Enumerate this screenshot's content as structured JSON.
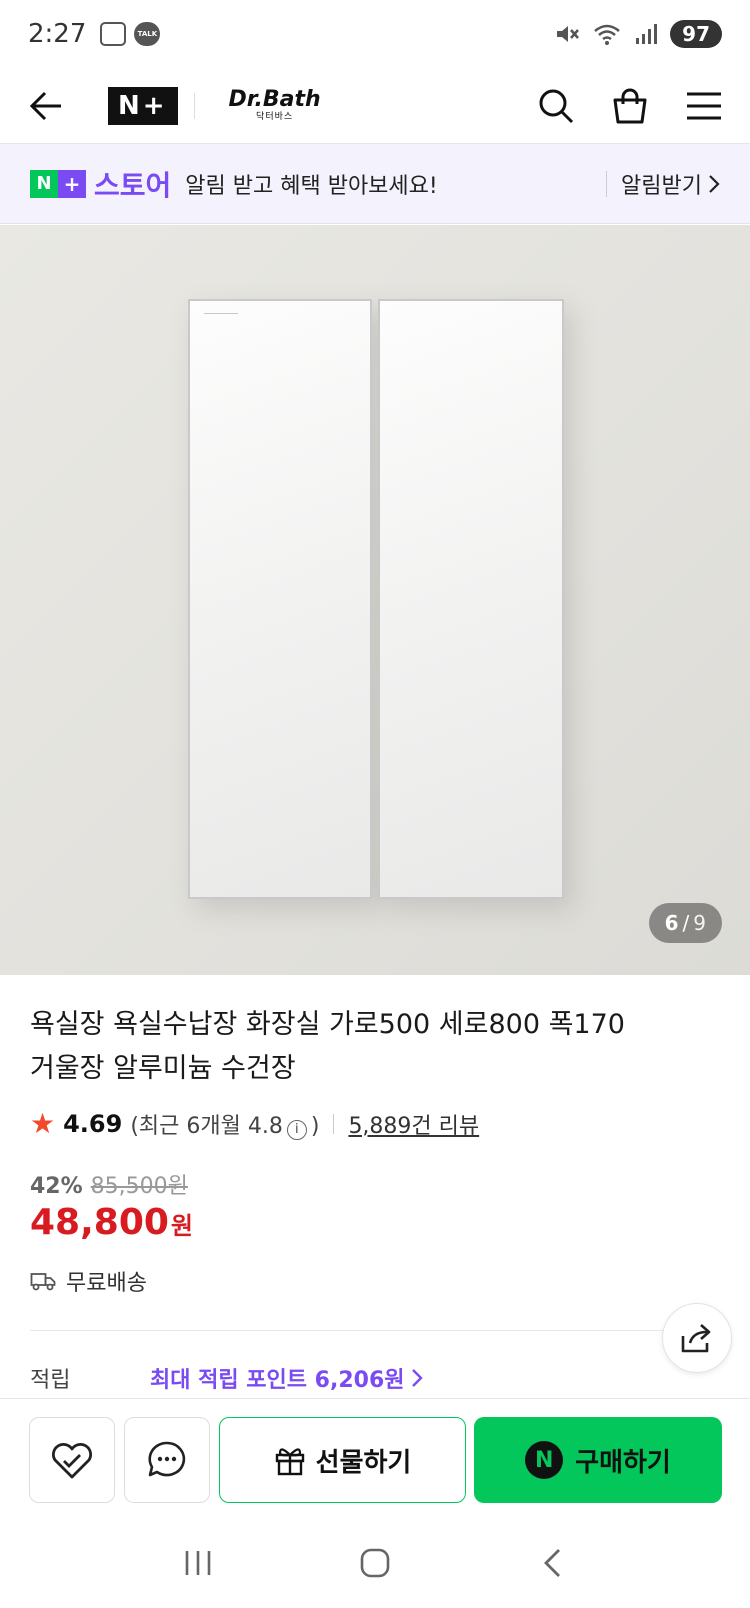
{
  "status_bar": {
    "time": "2:27",
    "talk_badge": "TALK",
    "battery": "97"
  },
  "header": {
    "nplus_logo": "N+",
    "brand_name": "Dr.Bath",
    "brand_sub": "닥터바스"
  },
  "promo": {
    "badge_n": "N",
    "badge_plus": "+",
    "store_label": "스토어",
    "message": "알림 받고 혜택 받아보세요!",
    "cta": "알림받기"
  },
  "gallery": {
    "current": "6",
    "separator": "/",
    "total": "9"
  },
  "product": {
    "title_line1": "욕실장 욕실수납장 화장실 가로500 세로800 폭170",
    "title_line2": "거울장 알루미늄 수건장",
    "rating": "4.69",
    "recent_rating_prefix": "(최근 6개월 4.8",
    "recent_rating_suffix": ")",
    "info_glyph": "i",
    "review_count": "5,889건 리뷰",
    "discount_rate": "42%",
    "original_price": "85,500원",
    "price": "48,800",
    "price_unit": "원",
    "shipping": "무료배송",
    "points_label": "적립",
    "points_value": "최대 적립 포인트 6,206원"
  },
  "actions": {
    "gift_label": "선물하기",
    "buy_n": "N",
    "buy_label": "구매하기"
  },
  "colors": {
    "naver_green": "#03c75a",
    "nplus_purple": "#7a4bf2",
    "price_red": "#d81b21",
    "star": "#f04a2a"
  },
  "icons": [
    "arrow-left-icon",
    "search-icon",
    "shopping-bag-icon",
    "menu-icon",
    "chevron-right-icon",
    "star-icon",
    "info-icon",
    "truck-icon",
    "share-icon",
    "heart-icon",
    "chat-bubble-icon",
    "gift-icon",
    "recent-apps-icon",
    "home-icon",
    "back-nav-icon"
  ]
}
